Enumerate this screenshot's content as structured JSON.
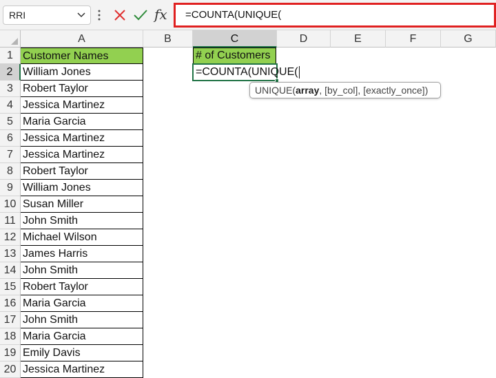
{
  "formula_bar": {
    "name_box": "RRI",
    "fx_label": "fx",
    "formula": "=COUNTA(UNIQUE("
  },
  "columns": [
    "A",
    "B",
    "C",
    "D",
    "E",
    "F",
    "G"
  ],
  "rows": [
    "1",
    "2",
    "3",
    "4",
    "5",
    "6",
    "7",
    "8",
    "9",
    "10",
    "11",
    "12",
    "13",
    "14",
    "15",
    "16",
    "17",
    "18",
    "19",
    "20"
  ],
  "column_a": [
    "Customer Names",
    "William Jones",
    "Robert Taylor",
    "Jessica Martinez",
    "Maria Garcia",
    "Jessica Martinez",
    "Jessica Martinez",
    "Robert Taylor",
    "William Jones",
    "Susan Miller",
    "John Smith",
    "Michael Wilson",
    "James Harris",
    "John Smith",
    "Robert Taylor",
    "Maria Garcia",
    "John Smith",
    "Maria Garcia",
    "Emily Davis",
    "Jessica Martinez"
  ],
  "cell_c1": "# of Customers",
  "cell_c2": "=COUNTA(UNIQUE(",
  "tooltip": {
    "fn": "UNIQUE(",
    "arg_bold": "array",
    "rest": ", [by_col], [exactly_once])"
  },
  "colors": {
    "header_fill": "#92d050",
    "active_green": "#217346",
    "highlight_red": "#e02020"
  }
}
